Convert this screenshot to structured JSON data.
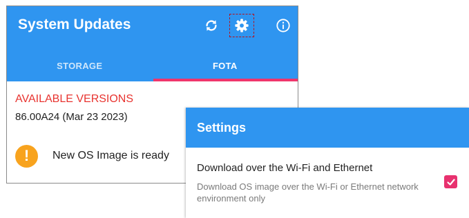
{
  "app": {
    "title": "System Updates",
    "icons": [
      "refresh-icon",
      "gear-icon",
      "info-icon"
    ],
    "tabs": [
      {
        "label": "STORAGE",
        "selected": false
      },
      {
        "label": "FOTA",
        "selected": true
      }
    ],
    "section_title": "AVAILABLE VERSIONS",
    "version": "86.00A24 (Mar 23 2023)",
    "status_icon": "!",
    "status_text": "New OS Image is ready"
  },
  "settings": {
    "title": "Settings",
    "option_title": "Download over the Wi-Fi and Ethernet",
    "option_summary": "Download OS image over the Wi-Fi or Ethernet network environment only",
    "checked": true
  },
  "colors": {
    "primary": "#2f95f0",
    "accent": "#e8316f",
    "error_text": "#e8332f",
    "warning": "#f8a31e"
  }
}
